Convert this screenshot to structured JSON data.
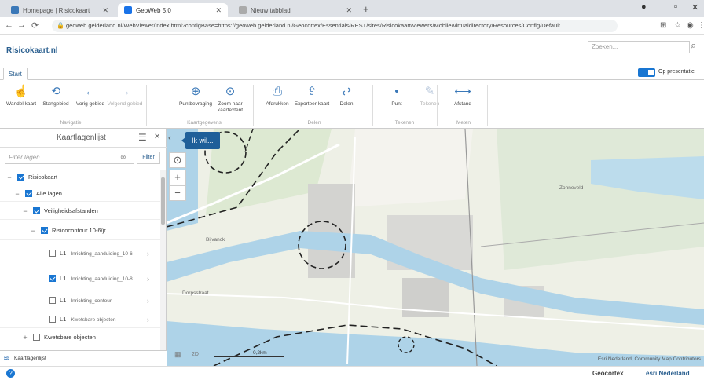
{
  "browser": {
    "tabs": [
      {
        "label": "Homepage | Risicokaart",
        "color": "#3a78b8",
        "active": false
      },
      {
        "label": "GeoWeb 5.0",
        "color": "#1a73e8",
        "active": true
      },
      {
        "label": "Nieuw tabblad",
        "color": "#aaaaaa",
        "active": false
      }
    ],
    "url": "geoweb.gelderland.nl/WebViewer/index.html?configBase=https://geoweb.gelderland.nl/Geocortex/Essentials/REST/sites/Risicokaart/viewers/Mobile/virtualdirectory/Resources/Config/Default"
  },
  "header": {
    "logo": "Risicokaart.nl",
    "search_placeholder": "Zoeken..."
  },
  "ribbon": {
    "tab": "Start",
    "toggle_label": "Op presentatie",
    "buttons": [
      {
        "label": "Wandel kaart",
        "icon": "hand-icon",
        "glyph": "☝",
        "disabled": false
      },
      {
        "label": "Startgebied",
        "icon": "home-icon",
        "glyph": "⟲",
        "disabled": false
      },
      {
        "label": "Vorig gebied",
        "icon": "back-icon",
        "glyph": "←",
        "disabled": false
      },
      {
        "label": "Volgend gebied",
        "icon": "forward-icon",
        "glyph": "→",
        "disabled": true
      },
      {
        "label": "Puntbevraging",
        "icon": "identify-icon",
        "glyph": "⊕",
        "disabled": false
      },
      {
        "label": "Zoom naar kaartextent",
        "icon": "zoom-icon",
        "glyph": "⊙",
        "disabled": false
      },
      {
        "label": "Afdrukken",
        "icon": "print-icon",
        "glyph": "⎙",
        "disabled": false
      },
      {
        "label": "Exporteer kaart",
        "icon": "export-icon",
        "glyph": "⇪",
        "disabled": false
      },
      {
        "label": "Delen",
        "icon": "share-icon",
        "glyph": "⇄",
        "disabled": false
      },
      {
        "label": "Punt",
        "icon": "point-icon",
        "glyph": "•",
        "disabled": false
      },
      {
        "label": "Tekenen",
        "icon": "draw-icon",
        "glyph": "✎",
        "disabled": true
      },
      {
        "label": "Afstand",
        "icon": "measure-icon",
        "glyph": "⟷",
        "disabled": false
      }
    ],
    "groups": [
      "Navigatie",
      "Kaartgegevens",
      "Delen",
      "Tekenen",
      "Meten"
    ]
  },
  "layers": {
    "title": "Kaartlagenlijst",
    "filter_placeholder": "Filter lagen...",
    "filter_button": "Filter",
    "rows": [
      {
        "label": "Risicokaart",
        "sub": "",
        "checked": true,
        "indent": 0,
        "toggle": "−"
      },
      {
        "label": "Alle lagen",
        "sub": "",
        "checked": true,
        "indent": 1,
        "toggle": "−"
      },
      {
        "label": "Veiligheidsafstanden",
        "sub": "",
        "checked": true,
        "indent": 2,
        "toggle": "−"
      },
      {
        "label": "Risicocontour 10-6/jr",
        "sub": "",
        "checked": true,
        "indent": 3,
        "toggle": "−"
      },
      {
        "label": "L1",
        "sub": "Inrichting_aanduiding_10-6",
        "checked": false,
        "indent": 4,
        "toggle": ""
      },
      {
        "label": "L1",
        "sub": "Inrichting_aanduiding_10-8",
        "checked": true,
        "indent": 4,
        "toggle": ""
      },
      {
        "label": "L1",
        "sub": "Inrichting_contour",
        "checked": false,
        "indent": 4,
        "toggle": ""
      },
      {
        "label": "L1",
        "sub": "Kwetsbare objecten",
        "checked": false,
        "indent": 4,
        "toggle": ""
      },
      {
        "label": "Kwetsbare objecten",
        "sub": "",
        "checked": false,
        "indent": 2,
        "toggle": "+"
      }
    ],
    "footer": "Kaartlagenlijst"
  },
  "map": {
    "ik_wil": "Ik wil...",
    "scale": "0,2km",
    "attribution": "Esri Nederland, Community Map Contributors",
    "place_labels": [
      "Bijvanck",
      "Dorpsstraat",
      "Zonneveld"
    ]
  },
  "footer": {
    "brand1": "Geocortex",
    "brand2": "esri Nederland"
  }
}
